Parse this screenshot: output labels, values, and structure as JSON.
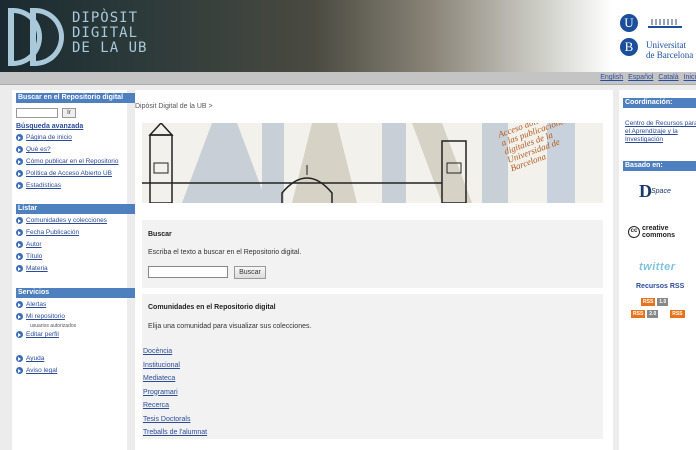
{
  "header": {
    "logo_lines": [
      "DIPÒSIT",
      "DIGITAL",
      "DE LA UB"
    ],
    "ub_letters": [
      "U",
      "B"
    ],
    "ub_name_lines": [
      "Universitat",
      "de Barcelona"
    ]
  },
  "topbar": {
    "languages": [
      "English",
      "Español",
      "Català",
      "Inici"
    ]
  },
  "left_sidebar": {
    "search_header": "Buscar en el Repositorio digital",
    "search_button": "Ir",
    "advanced_search": "Búsqueda avanzada",
    "links": [
      "Página de inicio",
      "Qué es?",
      "Cómo publicar en el Repositorio",
      "Política de Acceso Abierto UB",
      "Estadísticas"
    ],
    "browse_header": "Listar",
    "browse_links": [
      "Comunidades y colecciones",
      "Fecha Publicación",
      "Autor",
      "Título",
      "Materia"
    ],
    "services_header": "Servicios",
    "services_links": [
      "Alertas",
      "Mi repositorio",
      "Editar perfil"
    ],
    "authorized_note": "usuarios autorizados",
    "help_links": [
      "Ayuda",
      "Aviso legal"
    ]
  },
  "center": {
    "breadcrumb": "Dipòsit Digital de la UB >",
    "banner_text": [
      "Acceso abierto",
      "a las publicaciones",
      "digitales de la",
      "Universidad de",
      "Barcelona"
    ],
    "search_title": "Buscar",
    "search_instructions": "Escriba el texto a buscar en el Repositorio digital.",
    "search_button": "Buscar",
    "communities_title": "Comunidades en el Repositorio digital",
    "communities_instructions": "Elija una comunidad para visualizar sus colecciones.",
    "communities": [
      "Docència",
      "Institucional",
      "Mediateca",
      "Programari",
      "Recerca",
      "Tesis Doctorals",
      "Treballs de l'alumnat"
    ]
  },
  "right_sidebar": {
    "coordination_header": "Coordinación:",
    "coordination_link": "Centro de Recursos para el Aprendizaje y la Investigación",
    "based_on_header": "Basado en:",
    "dspace_d": "D",
    "dspace_label": "Space",
    "cc_icon": "cc",
    "cc_lines": [
      "creative",
      "commons"
    ],
    "twitter": "twitter",
    "rss_title": "Recursos RSS",
    "rss_badges_row1": [
      "RSS",
      "1.0"
    ],
    "rss_badges_row2": [
      "RSS",
      "2.0",
      "RSS"
    ]
  },
  "colors": {
    "section_header": "#4e7fbf",
    "link": "#2a4a9a",
    "logo_blue": "#a9c9da",
    "ub_blue": "#1b4f9c"
  }
}
